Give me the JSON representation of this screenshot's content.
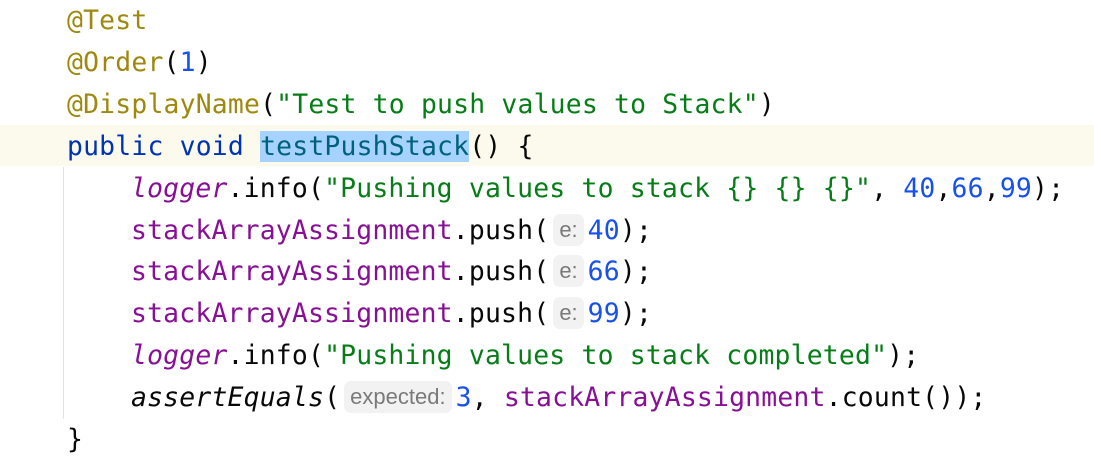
{
  "editor": {
    "colors": {
      "annotation": "#9e880d",
      "keyword": "#0033b3",
      "number": "#1750eb",
      "string": "#067d17",
      "field": "#871094",
      "selection": "#a6d2ff"
    },
    "lines": [
      {
        "indent": 0,
        "tokens": [
          {
            "k": "ann",
            "t": "@Test"
          }
        ]
      },
      {
        "indent": 0,
        "tokens": [
          {
            "k": "ann",
            "t": "@Order"
          },
          {
            "k": "",
            "t": "("
          },
          {
            "k": "num",
            "t": "1"
          },
          {
            "k": "",
            "t": ")"
          }
        ]
      },
      {
        "indent": 0,
        "tokens": [
          {
            "k": "ann",
            "t": "@DisplayName"
          },
          {
            "k": "",
            "t": "("
          },
          {
            "k": "str",
            "t": "\"Test to push values to Stack\""
          },
          {
            "k": "",
            "t": ")"
          }
        ]
      },
      {
        "indent": 0,
        "tokens": [
          {
            "k": "kw",
            "t": "public void "
          },
          {
            "k": "decl",
            "t": "testPushStack"
          },
          {
            "k": "",
            "t": "() {"
          }
        ]
      },
      {
        "indent": 1,
        "tokens": [
          {
            "k": "ital",
            "t": "logger"
          },
          {
            "k": "",
            "t": ".info("
          },
          {
            "k": "str",
            "t": "\"Pushing values to stack {} {} {}\""
          },
          {
            "k": "",
            "t": ", "
          },
          {
            "k": "num",
            "t": "40"
          },
          {
            "k": "",
            "t": ","
          },
          {
            "k": "num",
            "t": "66"
          },
          {
            "k": "",
            "t": ","
          },
          {
            "k": "num",
            "t": "99"
          },
          {
            "k": "",
            "t": ");"
          }
        ]
      },
      {
        "indent": 1,
        "tokens": [
          {
            "k": "fld",
            "t": "stackArrayAssignment"
          },
          {
            "k": "",
            "t": ".push("
          },
          {
            "k": "hint",
            "t": "e:"
          },
          {
            "k": "num",
            "t": "40"
          },
          {
            "k": "",
            "t": ");"
          }
        ]
      },
      {
        "indent": 1,
        "tokens": [
          {
            "k": "fld",
            "t": "stackArrayAssignment"
          },
          {
            "k": "",
            "t": ".push("
          },
          {
            "k": "hint",
            "t": "e:"
          },
          {
            "k": "num",
            "t": "66"
          },
          {
            "k": "",
            "t": ");"
          }
        ]
      },
      {
        "indent": 1,
        "tokens": [
          {
            "k": "fld",
            "t": "stackArrayAssignment"
          },
          {
            "k": "",
            "t": ".push("
          },
          {
            "k": "hint",
            "t": "e:"
          },
          {
            "k": "num",
            "t": "99"
          },
          {
            "k": "",
            "t": ");"
          }
        ]
      },
      {
        "indent": 1,
        "tokens": [
          {
            "k": "ital",
            "t": "logger"
          },
          {
            "k": "",
            "t": ".info("
          },
          {
            "k": "str",
            "t": "\"Pushing values to stack completed\""
          },
          {
            "k": "",
            "t": ");"
          }
        ]
      },
      {
        "indent": 1,
        "tokens": [
          {
            "k": "static",
            "t": "assertEquals"
          },
          {
            "k": "",
            "t": "("
          },
          {
            "k": "hint",
            "t": "expected:"
          },
          {
            "k": "num",
            "t": "3"
          },
          {
            "k": "",
            "t": ", "
          },
          {
            "k": "fld",
            "t": "stackArrayAssignment"
          },
          {
            "k": "",
            "t": ".count());"
          }
        ]
      },
      {
        "indent": 0,
        "tokens": [
          {
            "k": "",
            "t": "}"
          }
        ]
      }
    ]
  }
}
